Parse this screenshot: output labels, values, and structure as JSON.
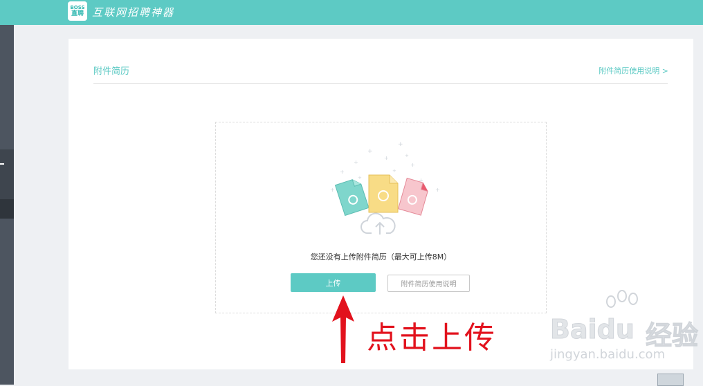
{
  "header": {
    "logo_top": "BOSS",
    "logo_bottom": "直聘",
    "slogan": "互联网招聘神器"
  },
  "page": {
    "title": "附件简历",
    "help_link": "附件简历使用说明 >"
  },
  "upload": {
    "empty_message": "您还没有上传附件简历（最大可上传8M）",
    "upload_button": "上传",
    "guide_button": "附件简历使用说明"
  },
  "overlay": {
    "annotation": "点击上传",
    "watermark_brand": "Baidu",
    "watermark_cn": "经验",
    "watermark_url": "jingyan.baidu.com"
  },
  "colors": {
    "accent": "#5dcac4",
    "annotation_red": "#e2121d",
    "sidebar": "#4d5560"
  },
  "icons": [
    "document-upload-illustration",
    "cloud-upload-icon",
    "up-arrow-annotation"
  ]
}
